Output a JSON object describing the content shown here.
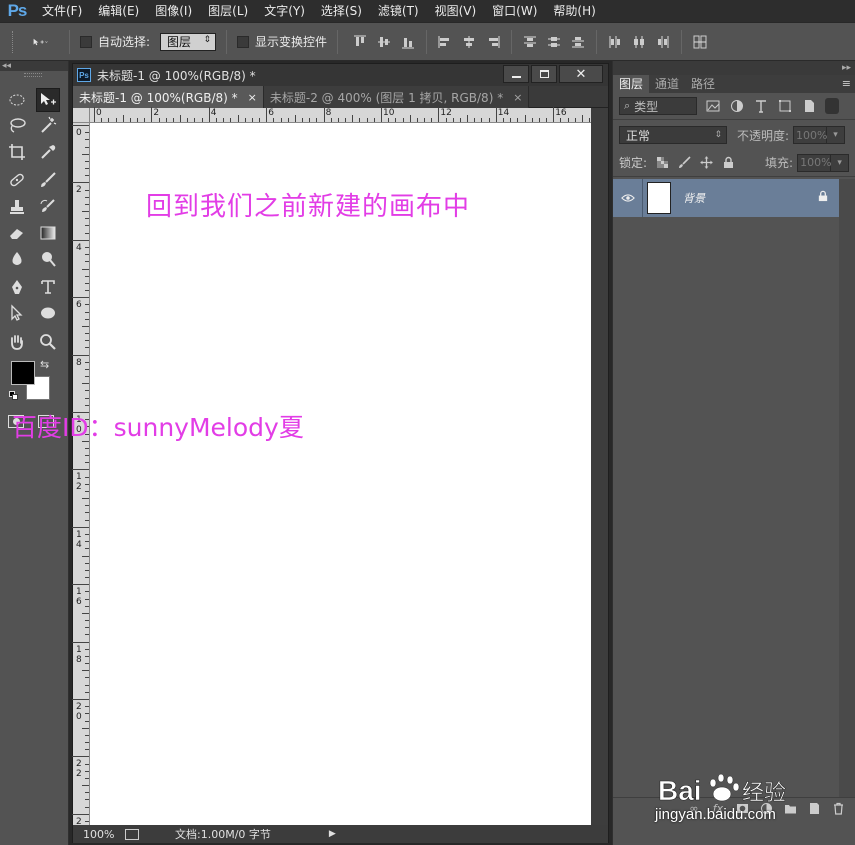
{
  "app": {
    "logo": "Ps",
    "menu": [
      "文件(F)",
      "编辑(E)",
      "图像(I)",
      "图层(L)",
      "文字(Y)",
      "选择(S)",
      "滤镜(T)",
      "视图(V)",
      "窗口(W)",
      "帮助(H)"
    ]
  },
  "options": {
    "auto_select_label": "自动选择:",
    "auto_select_target": "图层",
    "show_transform_label": "显示变换控件"
  },
  "document": {
    "window_title": "未标题-1 @ 100%(RGB/8) *",
    "tabs": [
      {
        "label": "未标题-1 @ 100%(RGB/8) *",
        "close": "×"
      },
      {
        "label": "未标题-2 @ 400% (图层 1 拷贝, RGB/8) *",
        "close": "×"
      }
    ],
    "ruler_h": [
      "0",
      "2",
      "4",
      "6",
      "8",
      "10",
      "12",
      "14",
      "16"
    ],
    "ruler_v": [
      [
        "0"
      ],
      [
        "2"
      ],
      [
        "4"
      ],
      [
        "6"
      ],
      [
        "8"
      ],
      [
        "1",
        "0"
      ],
      [
        "1",
        "2"
      ],
      [
        "1",
        "4"
      ],
      [
        "1",
        "6"
      ],
      [
        "1",
        "8"
      ],
      [
        "2",
        "0"
      ],
      [
        "2",
        "2"
      ],
      [
        "2",
        "4"
      ]
    ],
    "zoom": "100%",
    "status": "文档:1.00M/0 字节"
  },
  "layers_panel": {
    "tabs": [
      "图层",
      "通道",
      "路径"
    ],
    "filter_label": "类型",
    "blend_mode": "正常",
    "opacity_label": "不透明度:",
    "opacity_value": "100%",
    "lock_label": "锁定:",
    "fill_label": "填充:",
    "fill_value": "100%",
    "layer_name": "背景"
  },
  "overlay": {
    "caption": "回到我们之前新建的画布中",
    "author": "百度ID：sunnyMelody夏",
    "watermark_url": "jingyan.baidu.com"
  },
  "colors": {
    "overlay_text": "#e23de6",
    "selected_layer": "#6a7e98",
    "foreground": "#000000",
    "background": "#ffffff"
  }
}
